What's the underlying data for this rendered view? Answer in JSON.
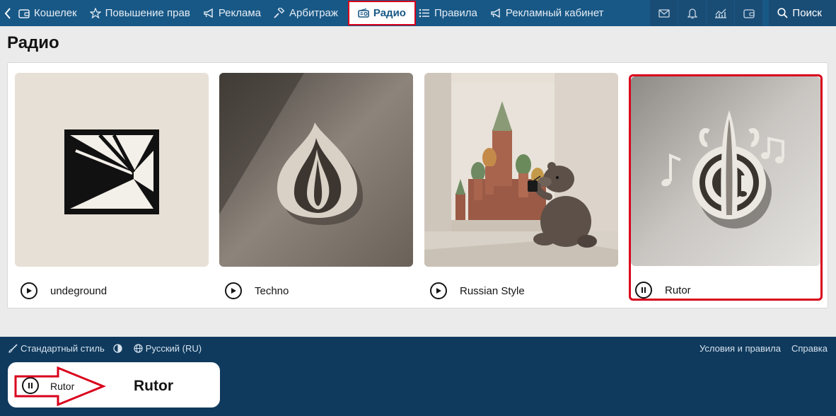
{
  "nav": {
    "back_icon": "chevron-left-icon",
    "items": [
      {
        "label": "Кошелек",
        "icon": "wallet-icon"
      },
      {
        "label": "Повышение прав",
        "icon": "star-icon"
      },
      {
        "label": "Реклама",
        "icon": "megaphone-icon"
      },
      {
        "label": "Арбитраж",
        "icon": "gavel-icon"
      },
      {
        "label": "Радио",
        "icon": "radio-icon",
        "active": true
      },
      {
        "label": "Правила",
        "icon": "list-icon"
      },
      {
        "label": "Рекламный кабинет",
        "icon": "megaphone-icon"
      }
    ],
    "right_icons": [
      "mail-icon",
      "bell-icon",
      "chart-icon",
      "wallet-icon"
    ],
    "search_label": "Поиск"
  },
  "page": {
    "title": "Радио"
  },
  "stations": [
    {
      "label": "undeground",
      "state": "play",
      "art": "tunnel-art"
    },
    {
      "label": "Techno",
      "state": "play",
      "art": "onion-art"
    },
    {
      "label": "Russian Style",
      "state": "play",
      "art": "kremlin-bear-art"
    },
    {
      "label": "Rutor",
      "state": "pause",
      "art": "music-onion-art",
      "selected": true
    }
  ],
  "footer": {
    "style_label": "Стандартный стиль",
    "language_label": "Русский (RU)",
    "terms_label": "Условия и правила",
    "help_label": "Справка"
  },
  "player": {
    "state": "pause",
    "label": "Rutor",
    "title": "Rutor"
  },
  "colors": {
    "nav_bg": "#185886",
    "footer_bg": "#0f3a5d",
    "highlight": "#d9001b",
    "page_bg": "#ebebeb"
  }
}
